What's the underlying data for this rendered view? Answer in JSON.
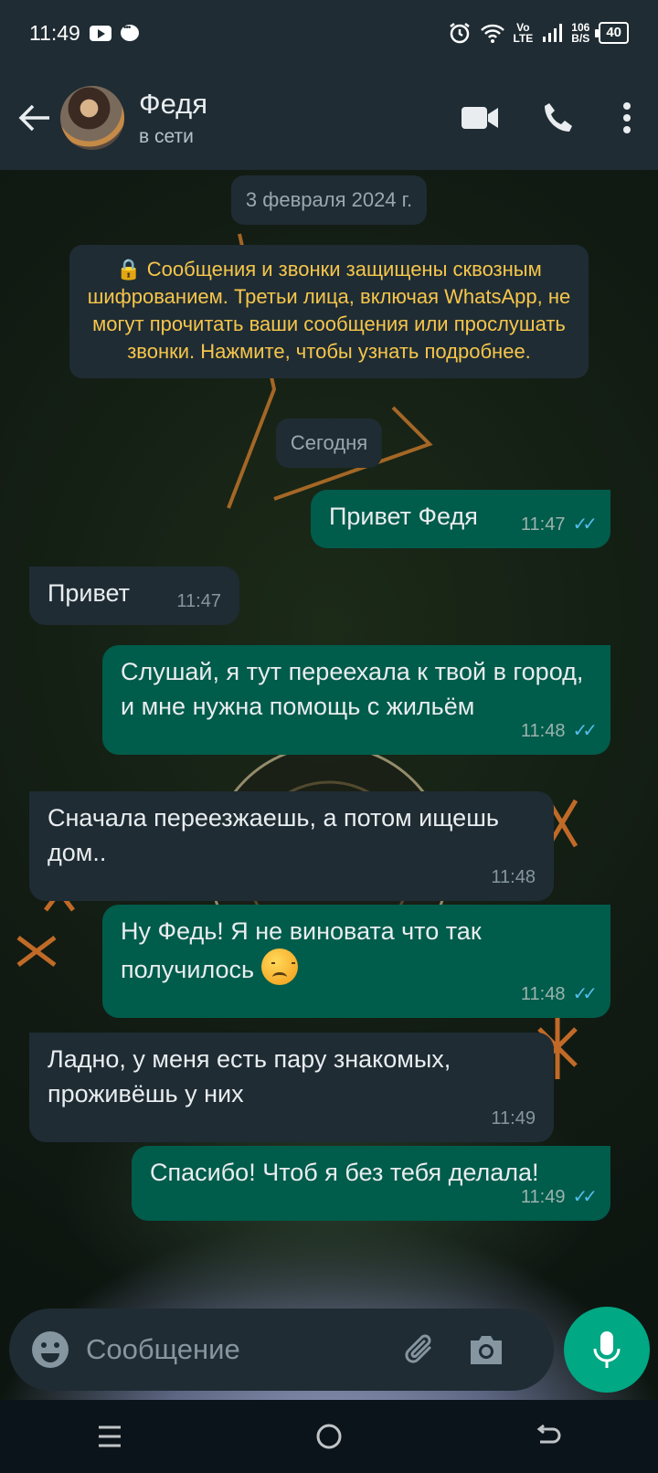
{
  "status_bar": {
    "time": "11:49",
    "net_top": "Vo",
    "net_bottom": "LTE",
    "speed_top": "106",
    "speed_bottom": "B/S",
    "battery": "40"
  },
  "header": {
    "contact_name": "Федя",
    "contact_status": "в сети",
    "icons": [
      "back-arrow-icon",
      "video-call-icon",
      "voice-call-icon",
      "more-options-icon"
    ]
  },
  "chat": {
    "date_label": "3 февраля 2024 г.",
    "encryption_notice": "🔒 Сообщения и звонки защищены сквозным шифрованием. Третьи лица, включая WhatsApp, не могут прочитать ваши сообщения или прослушать звонки. Нажмите, чтобы узнать подробнее.",
    "today_label": "Сегодня",
    "messages": [
      {
        "direction": "out",
        "text": "Привет Федя",
        "time": "11:47",
        "read": true
      },
      {
        "direction": "in",
        "text": "Привет",
        "time": "11:47"
      },
      {
        "direction": "out",
        "text": "Слушай, я тут переехала к твой в город, и мне нужна помощь с жильём",
        "time": "11:48",
        "read": true
      },
      {
        "direction": "in",
        "text": "Сначала переезжаешь, а потом ищешь дом..",
        "time": "11:48"
      },
      {
        "direction": "out",
        "text": "Ну Федь! Я не виновата что так получилось",
        "emoji": "😞",
        "time": "11:48",
        "read": true
      },
      {
        "direction": "in",
        "text": "Ладно, у меня есть пару знакомых, проживёшь у них",
        "time": "11:49"
      },
      {
        "direction": "out",
        "text": "Спасибо! Чтоб я без тебя делала!",
        "time": "11:49",
        "read": true
      }
    ],
    "read_ticks": "✓✓"
  },
  "composer": {
    "placeholder": "Сообщение",
    "icons": [
      "emoji-icon",
      "attach-icon",
      "camera-icon",
      "mic-icon"
    ]
  },
  "colors": {
    "header_bg": "#1f2c34",
    "outgoing_bubble": "#005c4b",
    "incoming_bubble": "#1f2c34",
    "accent": "#00a884",
    "read_ticks": "#53bdeb",
    "notice_text": "#f7c64a"
  }
}
